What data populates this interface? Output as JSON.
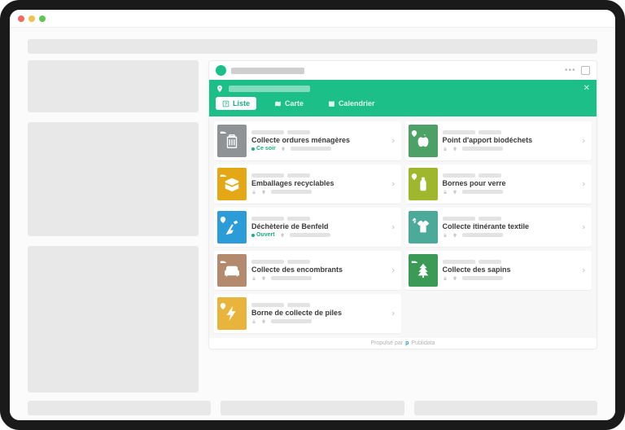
{
  "tabs": {
    "list": "Liste",
    "map": "Carte",
    "calendar": "Calendrier"
  },
  "cards": [
    {
      "title": "Collecte ordures ménagères",
      "status_text": "Ce soir",
      "status_kind": "green",
      "color": "#8f9396",
      "icon": "trash"
    },
    {
      "title": "Point d'apport biodéchets",
      "color": "#4da167",
      "icon": "apple"
    },
    {
      "title": "Emballages recyclables",
      "color": "#e4a816",
      "icon": "box"
    },
    {
      "title": "Bornes pour verre",
      "color": "#9fb72d",
      "icon": "bottle"
    },
    {
      "title": "Déchèterie de Benfeld",
      "status_text": "Ouvert",
      "status_kind": "green",
      "color": "#2b9cd8",
      "icon": "scope"
    },
    {
      "title": "Collecte itinérante textile",
      "color": "#4caa9a",
      "icon": "tshirt"
    },
    {
      "title": "Collecte des encombrants",
      "color": "#b38a6d",
      "icon": "sofa"
    },
    {
      "title": "Collecte des sapins",
      "color": "#3a9a56",
      "icon": "tree"
    },
    {
      "title": "Borne de collecte de piles",
      "color": "#e9b43c",
      "icon": "bolt"
    }
  ],
  "powered": {
    "prefix": "Propulsé par",
    "brand": "Publidata"
  }
}
